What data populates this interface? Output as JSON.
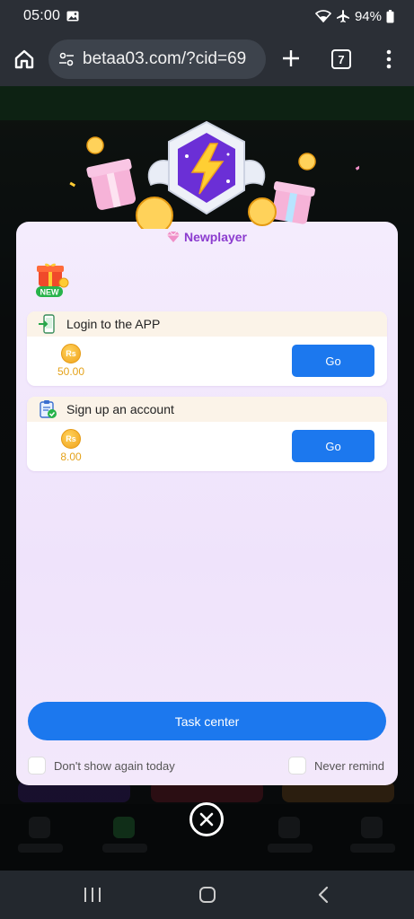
{
  "status_bar": {
    "time": "05:00",
    "battery": "94%",
    "icons": [
      "gallery-icon",
      "wifi-icon",
      "airplane-icon",
      "battery-icon"
    ]
  },
  "browser": {
    "url": "betaa03.com/?cid=69",
    "tab_count": "7",
    "icons": [
      "home-icon",
      "site-settings-icon",
      "plus-icon",
      "tabs-icon",
      "menu-icon"
    ]
  },
  "modal": {
    "title": "Newplayer",
    "badge_text": "NEW",
    "tasks": [
      {
        "name": "Login to the APP",
        "reward": "50.00",
        "currency_symbol": "Rs",
        "button": "Go",
        "icon": "phone-login-icon"
      },
      {
        "name": "Sign up an account",
        "reward": "8.00",
        "currency_symbol": "Rs",
        "button": "Go",
        "icon": "clipboard-check-icon"
      }
    ],
    "task_center_button": "Task center",
    "dont_show_today": "Don't show again today",
    "never_remind": "Never remind"
  },
  "colors": {
    "primary_button": "#1c78ee",
    "title_purple": "#8c3ccf",
    "reward_gold": "#e4a21a",
    "modal_bg": "#f0e5fb"
  }
}
